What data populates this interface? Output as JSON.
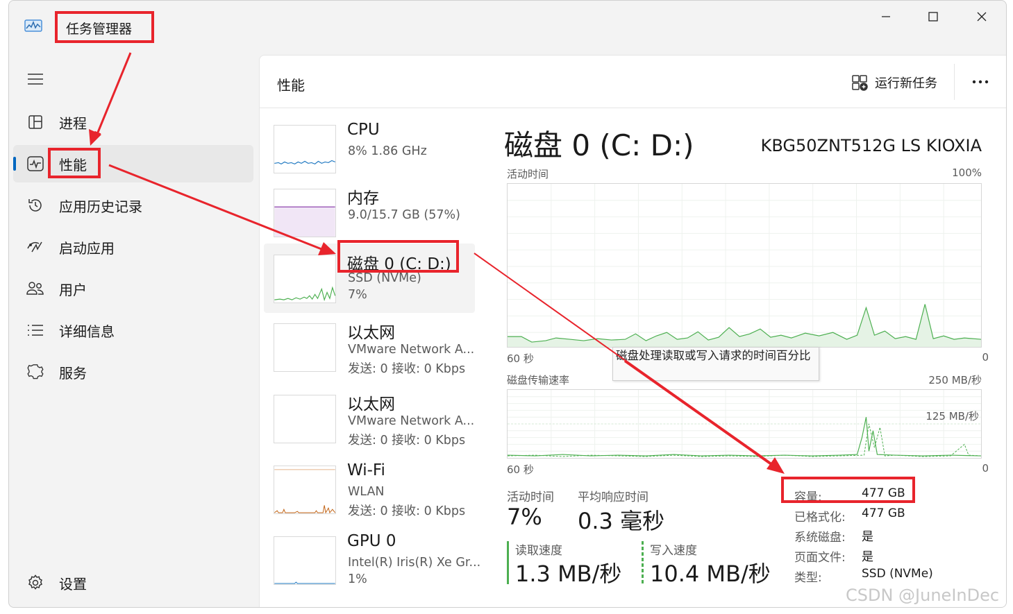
{
  "window": {
    "title": "任务管理器"
  },
  "sidebar": {
    "items": [
      {
        "id": "processes",
        "label": "进程",
        "icon": "processes-icon"
      },
      {
        "id": "performance",
        "label": "性能",
        "icon": "performance-icon",
        "active": true
      },
      {
        "id": "app-history",
        "label": "应用历史记录",
        "icon": "history-icon"
      },
      {
        "id": "startup",
        "label": "启动应用",
        "icon": "startup-icon"
      },
      {
        "id": "users",
        "label": "用户",
        "icon": "users-icon"
      },
      {
        "id": "details",
        "label": "详细信息",
        "icon": "details-icon"
      },
      {
        "id": "services",
        "label": "服务",
        "icon": "services-icon"
      }
    ],
    "settings_label": "设置"
  },
  "header": {
    "title": "性能",
    "run_task_label": "运行新任务",
    "more_label": "···"
  },
  "devices": [
    {
      "name": "CPU",
      "line1": "8%  1.86 GHz",
      "line2": ""
    },
    {
      "name": "内存",
      "line1": "9.0/15.7 GB (57%)",
      "line2": ""
    },
    {
      "name": "磁盘 0 (C: D:)",
      "line1": "SSD (NVMe)",
      "line2": "7%",
      "selected": true
    },
    {
      "name": "以太网",
      "line1": "VMware Network A...",
      "line2": "发送: 0 接收: 0 Kbps"
    },
    {
      "name": "以太网",
      "line1": "VMware Network A...",
      "line2": "发送: 0 接收: 0 Kbps"
    },
    {
      "name": "Wi-Fi",
      "line1": "WLAN",
      "line2": "发送: 0 接收: 0 Kbps"
    },
    {
      "name": "GPU 0",
      "line1": "Intel(R) Iris(R) Xe Gr...",
      "line2": "1%"
    }
  ],
  "detail": {
    "title": "磁盘 0 (C: D:)",
    "model": "KBG50ZNT512G LS KIOXIA",
    "graph1": {
      "label": "活动时间",
      "max": "100%",
      "time": "60 秒",
      "min": "0"
    },
    "graph2": {
      "label": "磁盘传输速率",
      "max": "250 MB/秒",
      "mid": "125 MB/秒",
      "time": "60 秒",
      "min": "0"
    },
    "tooltip": "磁盘处理读取或写入请求的时间百分比",
    "stats": {
      "active_label": "活动时间",
      "active_value": "7%",
      "response_label": "平均响应时间",
      "response_value": "0.3 毫秒",
      "read_label": "读取速度",
      "read_value": "1.3 MB/秒",
      "write_label": "写入速度",
      "write_value": "10.4 MB/秒"
    },
    "props": [
      {
        "k": "容量:",
        "v": "477 GB"
      },
      {
        "k": "已格式化:",
        "v": "477 GB"
      },
      {
        "k": "系统磁盘:",
        "v": "是"
      },
      {
        "k": "页面文件:",
        "v": "是"
      },
      {
        "k": "类型:",
        "v": "SSD (NVMe)"
      }
    ]
  },
  "colors": {
    "accent": "#0067c0",
    "disk_green": "#4caf50",
    "memory_purple": "#8e44ad",
    "annotation_red": "#e8242c"
  },
  "watermark": "CSDN @JuneInDec"
}
